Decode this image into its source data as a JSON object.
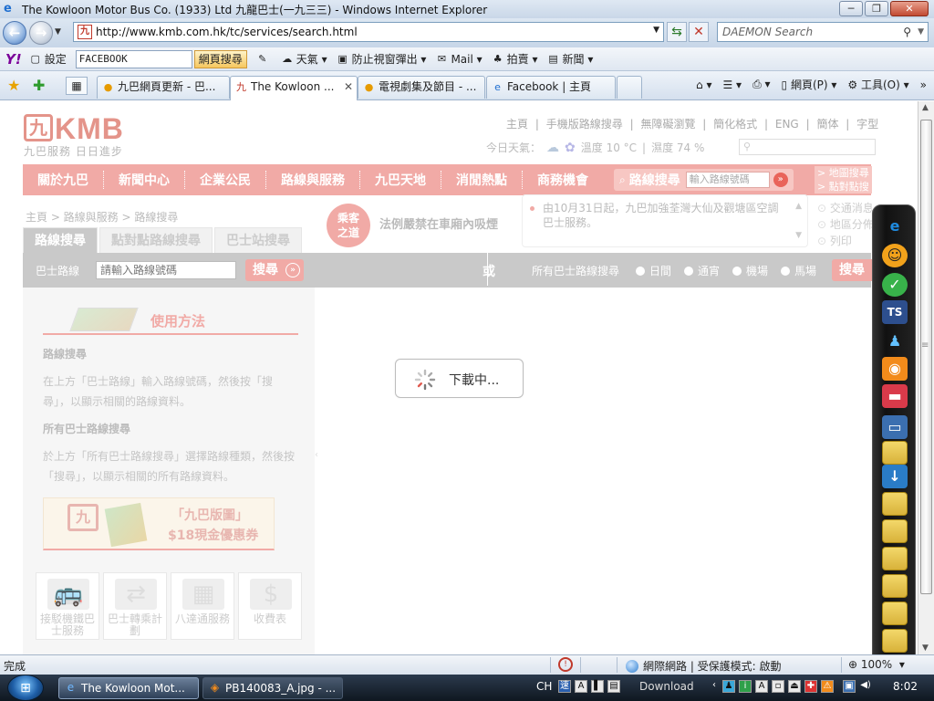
{
  "window": {
    "title": "The Kowloon Motor Bus Co. (1933) Ltd 九龍巴士(一九三三) - Windows Internet Explorer",
    "minimize": "─",
    "restore": "❐",
    "close": "✕"
  },
  "address_bar": {
    "url": "http://www.kmb.com.hk/tc/services/search.html",
    "search_placeholder": "DAEMON Search"
  },
  "yahoo_toolbar": {
    "logo": "Y!",
    "settings": "設定",
    "search_value": "FACEBOOK",
    "search_button": "網頁搜尋",
    "weather": "天氣",
    "popup_blocker": "防止視窗彈出",
    "mail": "Mail",
    "auction": "拍賣",
    "news": "新聞"
  },
  "tabs": [
    {
      "label": "九巴網頁更新 - 巴..."
    },
    {
      "label": "The Kowloon ..."
    },
    {
      "label": "電視劇集及節目 - ..."
    },
    {
      "label": "Facebook | 主頁"
    }
  ],
  "command_bar": {
    "page": "網頁(P)",
    "tools": "工具(O)"
  },
  "site": {
    "logo_word": "KMB",
    "logo_mark": "九",
    "slogan": "九巴服務  日日進步",
    "top_links": [
      "主頁",
      "|",
      "手機版路線搜尋",
      "|",
      "無障礙瀏覽",
      "|",
      "簡化格式",
      "|",
      "ENG",
      "|",
      "簡体",
      "|",
      "字型"
    ],
    "weather_label": "今日天氣：",
    "temperature": "溫度 10 °C",
    "humidity": "濕度 74 %",
    "nav": [
      "關於九巴",
      "新聞中心",
      "企業公民",
      "路線與服務",
      "九巴天地",
      "消閒熱點",
      "商務機會"
    ],
    "route_search_label": "路線搜尋",
    "route_search_placeholder": "輸入路線號碼",
    "right_links": [
      "> 地圖搜尋",
      "> 點對點搜"
    ],
    "breadcrumb": "主頁 > 路線與服務 > 路線搜尋",
    "subtabs": [
      "路線搜尋",
      "點對點路線搜尋",
      "巴士站搜尋"
    ],
    "notice_badge_line1": "乘客",
    "notice_badge_line2": "之道",
    "notice_text": "法例嚴禁在車廂內吸煙",
    "news_item": "由10月31日起，九巴加強荃灣大仙及觀塘區空調巴士服務。",
    "side_tools": [
      "交通消息",
      "地區分佈",
      "列印"
    ],
    "bus_route_label": "巴士路線",
    "bus_route_placeholder": "請輸入路線號碼",
    "search_button": "搜尋",
    "or_label": "或",
    "all_routes_label": "所有巴士路線搜尋",
    "route_types": [
      "日間",
      "通宵",
      "機場",
      "馬場"
    ],
    "search_button_2": "搜尋",
    "howto_title": "使用方法",
    "howto_h1": "路線搜尋",
    "howto_p1": "在上方「巴士路線」輸入路線號碼，然後按「搜尋」，以顯示相關的路線資料。",
    "howto_h2": "所有巴士路線搜尋",
    "howto_p2": "於上方「所有巴士路線搜尋」選擇路線種類，然後按「搜尋」，以顯示相關的所有路線資料。",
    "promo_line1": "「九巴版圖」",
    "promo_line2": "$18現金優惠券",
    "quick_links": [
      {
        "label": "接駁機鐵巴士服務",
        "icon": "🚌"
      },
      {
        "label": "巴士轉乘計劃",
        "icon": "⇄"
      },
      {
        "label": "八達通服務",
        "icon": "▦"
      },
      {
        "label": "收費表",
        "icon": "$"
      }
    ],
    "loading_text": "下載中..."
  },
  "status_bar": {
    "status": "完成",
    "zone": "網際網路 | 受保護模式: 啟動",
    "zoom": "100%"
  },
  "taskbar": {
    "start": "⊞",
    "tasks": [
      {
        "label": "The Kowloon Mot..."
      },
      {
        "label": "PB140083_A.jpg - ..."
      }
    ],
    "lang": "CH",
    "download": "Download",
    "clock": "8:02"
  },
  "colors": {
    "kmb_pink": "#f1aaa6",
    "kmb_red": "#e4948a",
    "grey_bar": "#c9c9c9"
  }
}
